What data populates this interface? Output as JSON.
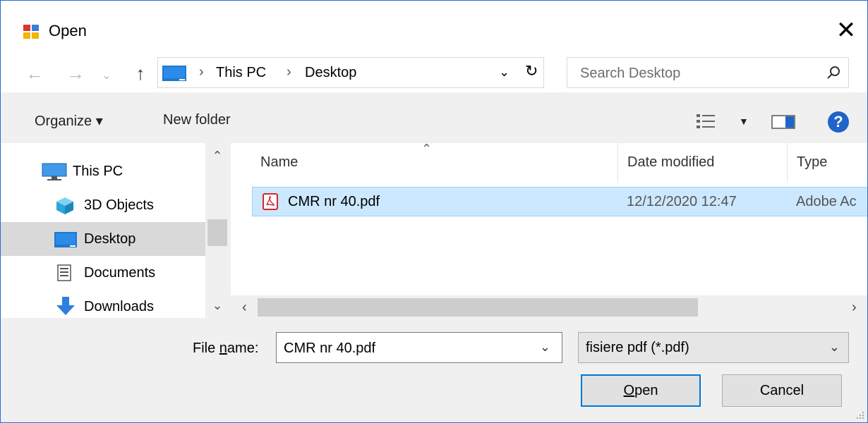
{
  "window": {
    "title": "Open"
  },
  "address": {
    "crumbs": [
      "This PC",
      "Desktop"
    ],
    "separator": "›"
  },
  "search": {
    "placeholder": "Search Desktop"
  },
  "toolbar": {
    "organize": "Organize ▾",
    "new_folder": "New folder",
    "help": "?"
  },
  "nav": {
    "items": [
      {
        "label": "This PC",
        "icon": "computer-icon"
      },
      {
        "label": "3D Objects",
        "icon": "cube-icon"
      },
      {
        "label": "Desktop",
        "icon": "desktop-icon",
        "selected": true
      },
      {
        "label": "Documents",
        "icon": "document-icon"
      },
      {
        "label": "Downloads",
        "icon": "download-icon"
      }
    ]
  },
  "files": {
    "columns": [
      "Name",
      "Date modified",
      "Type"
    ],
    "rows": [
      {
        "name": "CMR nr 40.pdf",
        "date": "12/12/2020 12:47",
        "type": "Adobe Ac",
        "icon": "pdf-icon"
      }
    ]
  },
  "footer": {
    "file_name_label_pre": "File ",
    "file_name_label_u": "n",
    "file_name_label_post": "ame:",
    "file_name_value": "CMR nr 40.pdf",
    "file_type": "fisiere pdf (*.pdf)",
    "open_u": "O",
    "open_rest": "pen",
    "cancel": "Cancel"
  },
  "colors": {
    "accent": "#0078d7",
    "selection": "#cce8ff",
    "selection_border": "#99d1ff",
    "nav_selected": "#d9d9d9"
  }
}
